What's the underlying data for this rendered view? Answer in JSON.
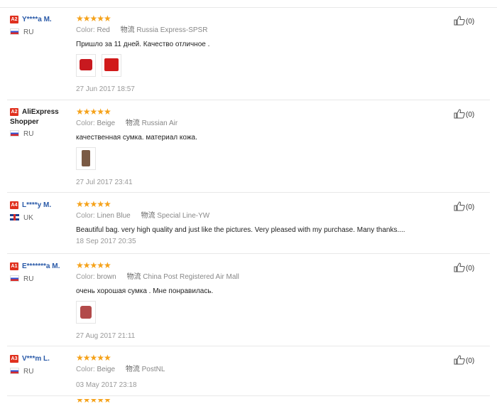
{
  "reviews": [
    {
      "badge": "A2",
      "user": "Y****a M.",
      "country": "RU",
      "flag": "ru",
      "color_label": "Color:",
      "color": "Red",
      "ship_label": "物流",
      "shipping": "Russia Express-SPSR",
      "text": "Пришло за 11 дней. Качество отличное .",
      "photos": [
        "red",
        "red"
      ],
      "date": "27 Jun 2017 18:57",
      "helpful": "(0)"
    },
    {
      "badge": "A2",
      "user": "AliExpress Shopper",
      "country": "RU",
      "flag": "ru",
      "color_label": "Color:",
      "color": "Beige",
      "ship_label": "物流",
      "shipping": "Russian Air",
      "text": "качественная сумка. материал кожа.",
      "photos": [
        "beige"
      ],
      "date": "27 Jul 2017 23:41",
      "helpful": "(0)"
    },
    {
      "badge": "A4",
      "user": "L****y M.",
      "country": "UK",
      "flag": "uk",
      "color_label": "Color:",
      "color": "Linen Blue",
      "ship_label": "物流",
      "shipping": "Special Line-YW",
      "text": "Beautiful bag. very high quality and just like the pictures. Very pleased with my purchase. Many thanks....",
      "photos": [],
      "date": "18 Sep 2017 20:35",
      "helpful": "(0)"
    },
    {
      "badge": "A1",
      "user": "E*******a M.",
      "country": "RU",
      "flag": "ru",
      "color_label": "Color:",
      "color": "brown",
      "ship_label": "物流",
      "shipping": "China Post Registered Air Mall",
      "text": "очень хорошая сумка . Мне понравилась.",
      "photos": [
        "brown"
      ],
      "date": "27 Aug 2017 21:11",
      "helpful": "(0)"
    },
    {
      "badge": "A3",
      "user": "V***m L.",
      "country": "RU",
      "flag": "ru",
      "color_label": "Color:",
      "color": "Beige",
      "ship_label": "物流",
      "shipping": "PostNL",
      "text": "",
      "photos": [],
      "date": "03 May 2017 23:18",
      "helpful": "(0)"
    }
  ],
  "stars": "★★★★★",
  "icons": {
    "thumb": "thumbs-up-icon",
    "star": "star-icon"
  },
  "colors": {
    "star": "#f5a21a",
    "badge": "#e0301e",
    "username": "#2a5aa8"
  }
}
